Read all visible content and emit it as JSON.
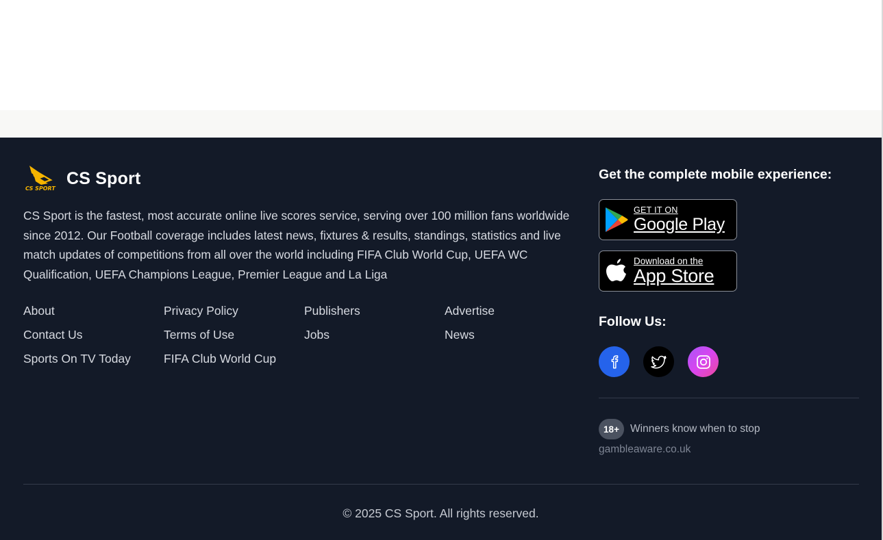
{
  "brand": {
    "name": "CS Sport",
    "logo_text": "CS SPORT"
  },
  "description": "CS Sport is the fastest, most accurate online live scores service, serving over 100 million fans worldwide since 2012. Our Football coverage includes latest news, fixtures & results, standings, statistics and live match updates of competitions from all over the world including FIFA Club World Cup, UEFA WC Qualification, UEFA Champions League, Premier League and La Liga",
  "links": {
    "about": "About",
    "privacy_policy": "Privacy Policy",
    "publishers": "Publishers",
    "advertise": "Advertise",
    "contact_us": "Contact Us",
    "terms_of_use": "Terms of Use",
    "jobs": "Jobs",
    "news": "News",
    "sports_on_tv_today": "Sports On TV Today",
    "fifa_club_world_cup": "FIFA Club World Cup"
  },
  "mobile": {
    "title": "Get the complete mobile experience:",
    "google_play": {
      "small": "GET IT ON",
      "big": "Google Play",
      "icon": "google-play-icon"
    },
    "app_store": {
      "small": "Download on the",
      "big": "App Store",
      "icon": "apple-icon"
    }
  },
  "follow": {
    "title": "Follow Us:",
    "networks": [
      {
        "name": "facebook",
        "icon": "facebook-icon",
        "color": "#2563eb"
      },
      {
        "name": "twitter",
        "icon": "twitter-icon",
        "color": "#000000"
      },
      {
        "name": "instagram",
        "icon": "instagram-icon",
        "color": "#d946ef"
      }
    ]
  },
  "gambling": {
    "badge": "18+",
    "message": "Winners know when to stop",
    "link": "gambleaware.co.uk"
  },
  "copyright": "© 2025 CS Sport. All rights reserved.",
  "colors": {
    "footer_bg": "#131a28",
    "accent_logo": "#f5b400",
    "facebook": "#2563eb",
    "instagram_gradient": [
      "#a855f7",
      "#ec4899"
    ]
  }
}
